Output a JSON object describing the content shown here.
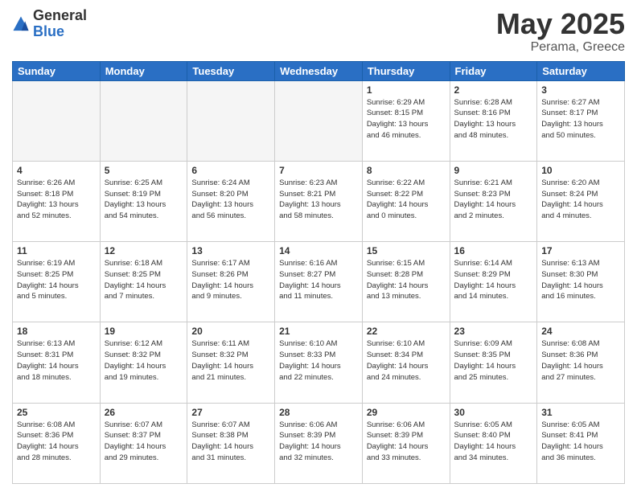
{
  "logo": {
    "general": "General",
    "blue": "Blue"
  },
  "title": {
    "month": "May 2025",
    "location": "Perama, Greece"
  },
  "headers": [
    "Sunday",
    "Monday",
    "Tuesday",
    "Wednesday",
    "Thursday",
    "Friday",
    "Saturday"
  ],
  "weeks": [
    [
      {
        "day": "",
        "info": "",
        "empty": true
      },
      {
        "day": "",
        "info": "",
        "empty": true
      },
      {
        "day": "",
        "info": "",
        "empty": true
      },
      {
        "day": "",
        "info": "",
        "empty": true
      },
      {
        "day": "1",
        "info": "Sunrise: 6:29 AM\nSunset: 8:15 PM\nDaylight: 13 hours\nand 46 minutes."
      },
      {
        "day": "2",
        "info": "Sunrise: 6:28 AM\nSunset: 8:16 PM\nDaylight: 13 hours\nand 48 minutes."
      },
      {
        "day": "3",
        "info": "Sunrise: 6:27 AM\nSunset: 8:17 PM\nDaylight: 13 hours\nand 50 minutes."
      }
    ],
    [
      {
        "day": "4",
        "info": "Sunrise: 6:26 AM\nSunset: 8:18 PM\nDaylight: 13 hours\nand 52 minutes."
      },
      {
        "day": "5",
        "info": "Sunrise: 6:25 AM\nSunset: 8:19 PM\nDaylight: 13 hours\nand 54 minutes."
      },
      {
        "day": "6",
        "info": "Sunrise: 6:24 AM\nSunset: 8:20 PM\nDaylight: 13 hours\nand 56 minutes."
      },
      {
        "day": "7",
        "info": "Sunrise: 6:23 AM\nSunset: 8:21 PM\nDaylight: 13 hours\nand 58 minutes."
      },
      {
        "day": "8",
        "info": "Sunrise: 6:22 AM\nSunset: 8:22 PM\nDaylight: 14 hours\nand 0 minutes."
      },
      {
        "day": "9",
        "info": "Sunrise: 6:21 AM\nSunset: 8:23 PM\nDaylight: 14 hours\nand 2 minutes."
      },
      {
        "day": "10",
        "info": "Sunrise: 6:20 AM\nSunset: 8:24 PM\nDaylight: 14 hours\nand 4 minutes."
      }
    ],
    [
      {
        "day": "11",
        "info": "Sunrise: 6:19 AM\nSunset: 8:25 PM\nDaylight: 14 hours\nand 5 minutes."
      },
      {
        "day": "12",
        "info": "Sunrise: 6:18 AM\nSunset: 8:25 PM\nDaylight: 14 hours\nand 7 minutes."
      },
      {
        "day": "13",
        "info": "Sunrise: 6:17 AM\nSunset: 8:26 PM\nDaylight: 14 hours\nand 9 minutes."
      },
      {
        "day": "14",
        "info": "Sunrise: 6:16 AM\nSunset: 8:27 PM\nDaylight: 14 hours\nand 11 minutes."
      },
      {
        "day": "15",
        "info": "Sunrise: 6:15 AM\nSunset: 8:28 PM\nDaylight: 14 hours\nand 13 minutes."
      },
      {
        "day": "16",
        "info": "Sunrise: 6:14 AM\nSunset: 8:29 PM\nDaylight: 14 hours\nand 14 minutes."
      },
      {
        "day": "17",
        "info": "Sunrise: 6:13 AM\nSunset: 8:30 PM\nDaylight: 14 hours\nand 16 minutes."
      }
    ],
    [
      {
        "day": "18",
        "info": "Sunrise: 6:13 AM\nSunset: 8:31 PM\nDaylight: 14 hours\nand 18 minutes."
      },
      {
        "day": "19",
        "info": "Sunrise: 6:12 AM\nSunset: 8:32 PM\nDaylight: 14 hours\nand 19 minutes."
      },
      {
        "day": "20",
        "info": "Sunrise: 6:11 AM\nSunset: 8:32 PM\nDaylight: 14 hours\nand 21 minutes."
      },
      {
        "day": "21",
        "info": "Sunrise: 6:10 AM\nSunset: 8:33 PM\nDaylight: 14 hours\nand 22 minutes."
      },
      {
        "day": "22",
        "info": "Sunrise: 6:10 AM\nSunset: 8:34 PM\nDaylight: 14 hours\nand 24 minutes."
      },
      {
        "day": "23",
        "info": "Sunrise: 6:09 AM\nSunset: 8:35 PM\nDaylight: 14 hours\nand 25 minutes."
      },
      {
        "day": "24",
        "info": "Sunrise: 6:08 AM\nSunset: 8:36 PM\nDaylight: 14 hours\nand 27 minutes."
      }
    ],
    [
      {
        "day": "25",
        "info": "Sunrise: 6:08 AM\nSunset: 8:36 PM\nDaylight: 14 hours\nand 28 minutes."
      },
      {
        "day": "26",
        "info": "Sunrise: 6:07 AM\nSunset: 8:37 PM\nDaylight: 14 hours\nand 29 minutes."
      },
      {
        "day": "27",
        "info": "Sunrise: 6:07 AM\nSunset: 8:38 PM\nDaylight: 14 hours\nand 31 minutes."
      },
      {
        "day": "28",
        "info": "Sunrise: 6:06 AM\nSunset: 8:39 PM\nDaylight: 14 hours\nand 32 minutes."
      },
      {
        "day": "29",
        "info": "Sunrise: 6:06 AM\nSunset: 8:39 PM\nDaylight: 14 hours\nand 33 minutes."
      },
      {
        "day": "30",
        "info": "Sunrise: 6:05 AM\nSunset: 8:40 PM\nDaylight: 14 hours\nand 34 minutes."
      },
      {
        "day": "31",
        "info": "Sunrise: 6:05 AM\nSunset: 8:41 PM\nDaylight: 14 hours\nand 36 minutes."
      }
    ]
  ]
}
